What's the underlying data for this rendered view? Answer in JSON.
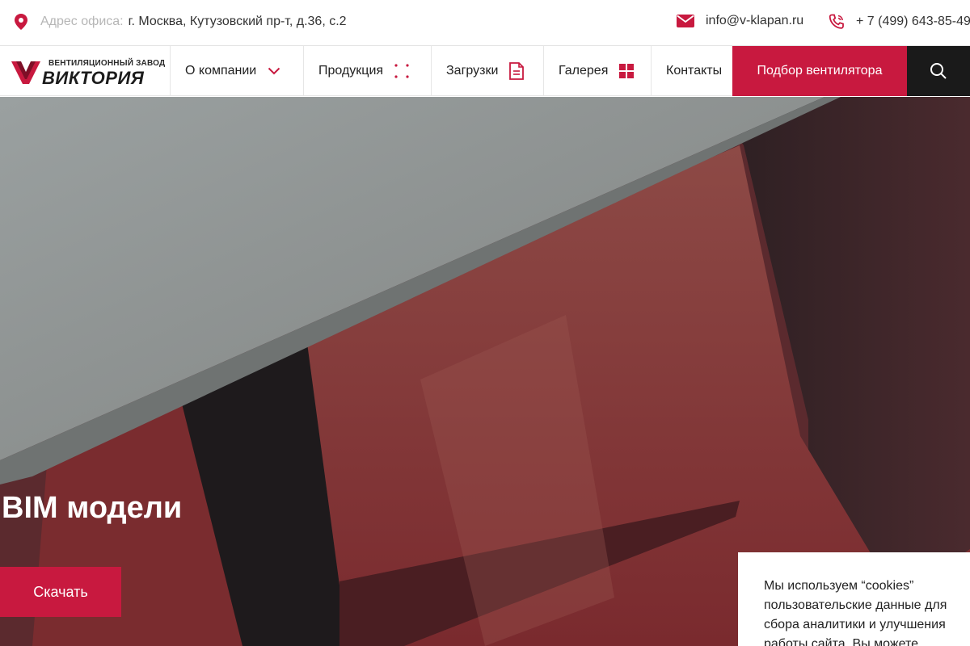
{
  "topbar": {
    "address_label": "Адрес офиса:",
    "address_value": "г. Москва, Кутузовский пр-т, д.36, с.2",
    "email": "info@v-klapan.ru",
    "phone": "+ 7 (499) 643-85-49"
  },
  "nav": {
    "logo_tagline": "ВЕНТИЛЯЦИОННЫЙ ЗАВОД",
    "logo_brand": "ВИКТОРИЯ",
    "items": [
      {
        "label": "О компании"
      },
      {
        "label": "Продукция"
      },
      {
        "label": "Загрузки"
      },
      {
        "label": "Галерея"
      },
      {
        "label": "Контакты"
      }
    ],
    "cta_label": "Подбор вентилятора"
  },
  "hero": {
    "title": "BIM модели",
    "button_label": "Скачать"
  },
  "cookie": {
    "text": "Мы используем “cookies” пользовательские данные для сбора аналитики и улучшения работы сайта. Вы можете принять"
  },
  "colors": {
    "accent": "#c8193f",
    "dark": "#1a1a1a"
  }
}
